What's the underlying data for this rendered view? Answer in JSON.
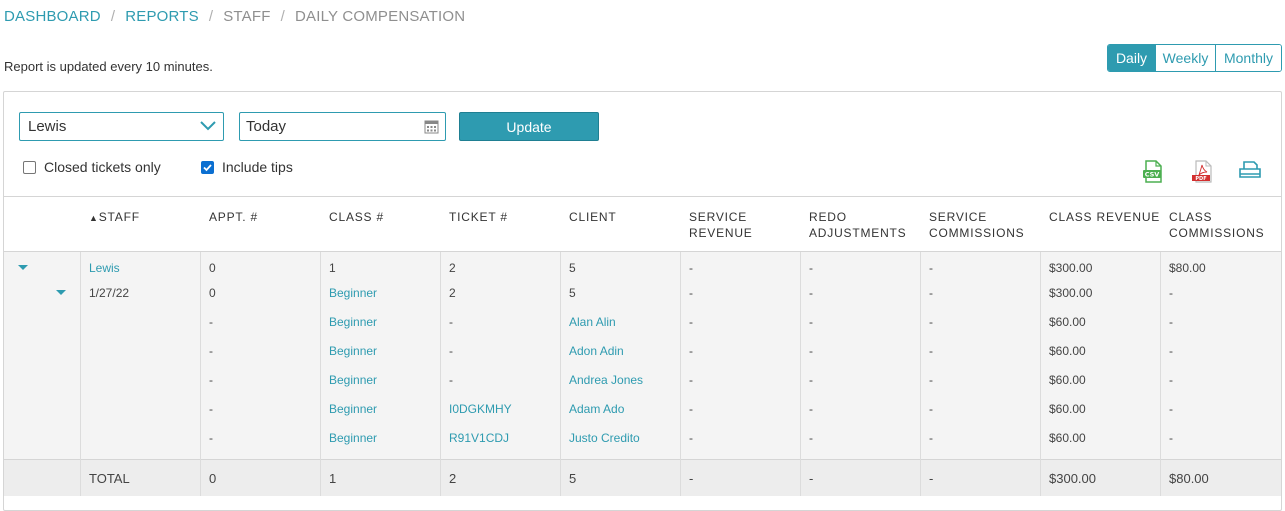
{
  "breadcrumb": {
    "items": [
      {
        "label": "DASHBOARD",
        "link": true
      },
      {
        "label": "REPORTS",
        "link": true
      },
      {
        "label": "STAFF",
        "link": false
      },
      {
        "label": "DAILY COMPENSATION",
        "link": false
      }
    ],
    "separator": "/"
  },
  "note": "Report is updated every 10 minutes.",
  "period_toggle": {
    "options": [
      "Daily",
      "Weekly",
      "Monthly"
    ],
    "selected": "Daily"
  },
  "filters": {
    "staff_value": "Lewis",
    "date_value": "Today",
    "update_label": "Update",
    "closed_only_label": "Closed tickets only",
    "closed_only_checked": false,
    "include_tips_label": "Include tips",
    "include_tips_checked": true
  },
  "exports": {
    "csv_label": "CSV",
    "pdf_label": "PDF"
  },
  "table": {
    "sort_indicator": "▲",
    "headers": {
      "staff": "STAFF",
      "appt": "APPT. #",
      "class": "CLASS #",
      "ticket": "TICKET #",
      "client": "CLIENT",
      "service_revenue": [
        "SERVICE",
        "REVENUE"
      ],
      "redo": [
        "REDO",
        "ADJUSTMENTS"
      ],
      "service_commissions": [
        "SERVICE",
        "COMMISSIONS"
      ],
      "class_revenue": "CLASS REVENUE",
      "class_commissions": [
        "CLASS",
        "COMMISSIONS"
      ]
    },
    "staff_row": {
      "staff": "Lewis",
      "appt": "0",
      "class": "1",
      "ticket": "2",
      "client": "5",
      "service_revenue": "-",
      "redo": "-",
      "service_commissions": "-",
      "class_revenue": "$300.00",
      "class_commissions": "$80.00"
    },
    "date_row": {
      "staff": "1/27/22",
      "appt": "0",
      "class": "Beginner",
      "ticket": "2",
      "client": "5",
      "service_revenue": "-",
      "redo": "-",
      "service_commissions": "-",
      "class_revenue": "$300.00",
      "class_commissions": "-"
    },
    "detail_rows": [
      {
        "appt": "-",
        "class": "Beginner",
        "ticket": "-",
        "client": "Alan Alin",
        "service_revenue": "-",
        "redo": "-",
        "service_commissions": "-",
        "class_revenue": "$60.00",
        "class_commissions": "-"
      },
      {
        "appt": "-",
        "class": "Beginner",
        "ticket": "-",
        "client": "Adon Adin",
        "service_revenue": "-",
        "redo": "-",
        "service_commissions": "-",
        "class_revenue": "$60.00",
        "class_commissions": "-"
      },
      {
        "appt": "-",
        "class": "Beginner",
        "ticket": "-",
        "client": "Andrea Jones",
        "service_revenue": "-",
        "redo": "-",
        "service_commissions": "-",
        "class_revenue": "$60.00",
        "class_commissions": "-"
      },
      {
        "appt": "-",
        "class": "Beginner",
        "ticket": "I0DGKMHY",
        "client": "Adam Ado",
        "service_revenue": "-",
        "redo": "-",
        "service_commissions": "-",
        "class_revenue": "$60.00",
        "class_commissions": "-"
      },
      {
        "appt": "-",
        "class": "Beginner",
        "ticket": "R91V1CDJ",
        "client": "Justo Credito",
        "service_revenue": "-",
        "redo": "-",
        "service_commissions": "-",
        "class_revenue": "$60.00",
        "class_commissions": "-"
      }
    ],
    "total_row": {
      "label": "TOTAL",
      "appt": "0",
      "class": "1",
      "ticket": "2",
      "client": "5",
      "service_revenue": "-",
      "redo": "-",
      "service_commissions": "-",
      "class_revenue": "$300.00",
      "class_commissions": "$80.00"
    }
  },
  "colors": {
    "accent": "#2e9bb0",
    "csv_icon": "#4caf50",
    "pdf_icon": "#d32f2f"
  }
}
